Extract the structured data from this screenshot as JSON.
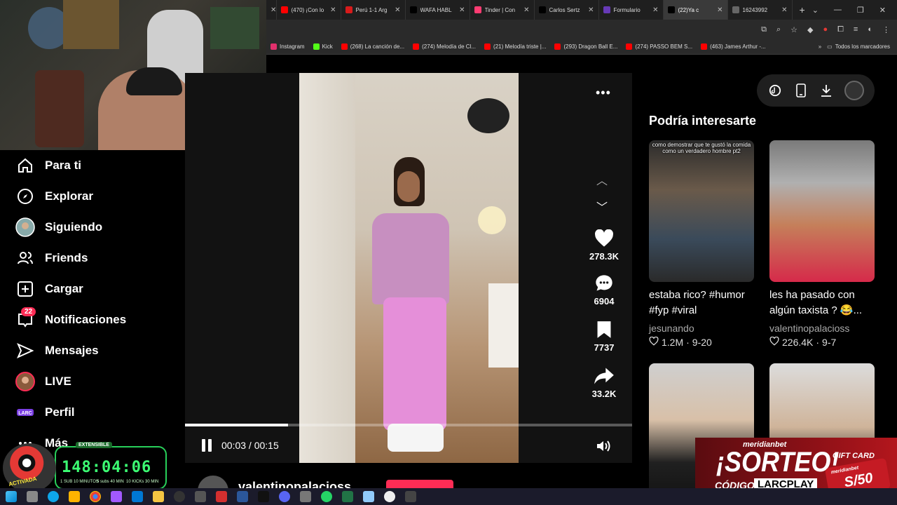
{
  "browser": {
    "tabs": [
      {
        "label": "(470) ¡Con lo",
        "color": "#ff0000",
        "active": false
      },
      {
        "label": "Perú 1-1 Arg",
        "color": "#d81b1b",
        "active": false
      },
      {
        "label": "WAFA HABL",
        "color": "#000000",
        "active": false
      },
      {
        "label": "Tinder | Con",
        "color": "#fe3c72",
        "active": false
      },
      {
        "label": "Carlos Sertz",
        "color": "#000000",
        "active": false
      },
      {
        "label": "Formulario",
        "color": "#673ab7",
        "active": false
      },
      {
        "label": "(22)Ya c",
        "color": "#000000",
        "active": true
      },
      {
        "label": "16243992",
        "color": "#666666",
        "active": false
      }
    ],
    "bookmarks": [
      {
        "label": "Instagram",
        "color": "#e1306c"
      },
      {
        "label": "Kick",
        "color": "#53fc18"
      },
      {
        "label": "(268) La canción de...",
        "color": "#ff0000"
      },
      {
        "label": "(274) Melodía de Cl...",
        "color": "#ff0000"
      },
      {
        "label": "(21) Melodía triste |...",
        "color": "#ff0000"
      },
      {
        "label": "(293) Dragon Ball E...",
        "color": "#ff0000"
      },
      {
        "label": "(274) PASSO BEM S...",
        "color": "#ff0000"
      },
      {
        "label": "(463) James Arthur -...",
        "color": "#ff0000"
      }
    ],
    "bookmarks_more": "»",
    "all_bookmarks": "Todos los marcadores"
  },
  "sidebar": {
    "items": [
      {
        "label": "Para ti",
        "icon": "home-icon"
      },
      {
        "label": "Explorar",
        "icon": "compass-icon"
      },
      {
        "label": "Siguiendo",
        "icon": "avatar-icon"
      },
      {
        "label": "Friends",
        "icon": "friends-icon"
      },
      {
        "label": "Cargar",
        "icon": "upload-icon"
      },
      {
        "label": "Notificaciones",
        "icon": "inbox-icon",
        "badge": "22"
      },
      {
        "label": "Mensajes",
        "icon": "send-icon"
      },
      {
        "label": "LIVE",
        "icon": "live-icon"
      },
      {
        "label": "Perfil",
        "icon": "profile-icon"
      },
      {
        "label": "Más",
        "icon": "more-icon"
      }
    ]
  },
  "timer": {
    "label": "EXTENSIBLE",
    "value": "148:04:06",
    "mascot_text": "ACTIVADA",
    "stats": [
      "1 SUB 10 MINUTOS",
      "5 subs 40 MIN",
      "10 KICKs 30 MIN"
    ]
  },
  "player": {
    "likes": "278.3K",
    "comments": "6904",
    "saves": "7737",
    "shares": "33.2K",
    "time": "00:03 / 00:15",
    "progress": 0.23,
    "author": "valentinopalacioss"
  },
  "suggestions": {
    "title": "Podría interesarte",
    "cards": [
      {
        "caption": "como demostrar que te gustó la comida como un verdadero hombre pt2",
        "desc": "estaba rico? #humor #fyp #viral",
        "author": "jesunando",
        "likes": "1.2M",
        "date": "9-20"
      },
      {
        "caption": "",
        "desc": "les ha pasado con algún taxista ? 😂...",
        "author": "valentinopalacioss",
        "likes": "226.4K",
        "date": "9-7"
      },
      {
        "caption": "",
        "desc": "",
        "author": "",
        "likes": "",
        "date": ""
      },
      {
        "caption": "",
        "desc": "",
        "author": "",
        "likes": "",
        "date": ""
      }
    ]
  },
  "sponsor": {
    "brand": "meridianbet",
    "title": "¡SORTEO!",
    "code_label": "CÓDIGO:",
    "code": "LARCPLAY",
    "gift": "GIFT CARD",
    "card_brand": "meridianbet",
    "amount": "S/50"
  },
  "colors": {
    "accent": "#fe2c55",
    "timer_green": "#3cff73",
    "sponsor_red": "#b3161d"
  }
}
